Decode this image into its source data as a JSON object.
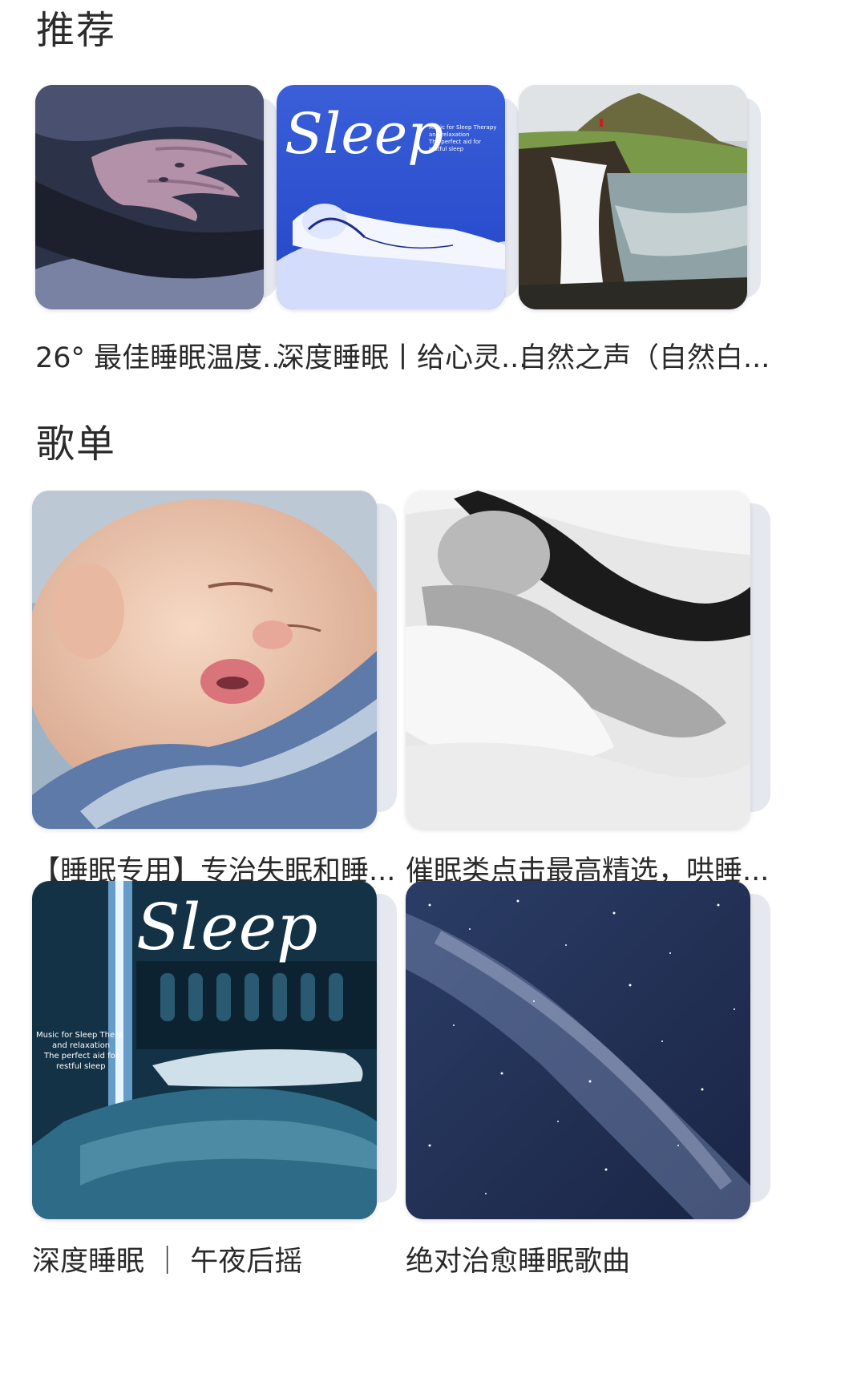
{
  "sections": {
    "recommended": {
      "title": "推荐",
      "items": [
        {
          "title": "26° 最佳睡眠温度...",
          "cover": "hands-painting-cover"
        },
        {
          "title": "深度睡眠丨给心灵...",
          "cover": "sleep-album-blue-cover",
          "cover_logo": "Sleep",
          "cover_subtitle": [
            "Music for Sleep Therapy",
            "and relaxation",
            "The perfect aid for",
            "restful sleep"
          ]
        },
        {
          "title": "自然之声（自然白...",
          "cover": "waterfall-landscape-cover"
        }
      ]
    },
    "playlists": {
      "title": "歌单",
      "items": [
        {
          "title": "【睡眠专用】专治失眠和睡...",
          "cover": "sleeping-baby-cover"
        },
        {
          "title": "催眠类点击最高精选，哄睡...",
          "cover": "sleeping-woman-bw-cover"
        },
        {
          "title": "深度睡眠 ｜ 午夜后摇",
          "cover": "sleep-bedroom-cover",
          "cover_logo": "Sleep",
          "cover_subtitle": [
            "Music for Sleep Thera",
            "and relaxation",
            "The perfect aid for",
            "restful sleep"
          ]
        },
        {
          "title": "绝对治愈睡眠歌曲",
          "cover": "milky-way-cover"
        }
      ]
    }
  }
}
